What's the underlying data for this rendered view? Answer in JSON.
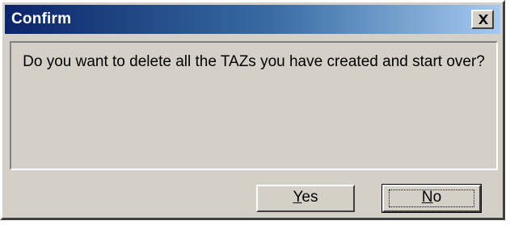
{
  "dialog": {
    "title": "Confirm",
    "close_icon": "close-icon",
    "message": "Do you want to delete all the TAZs you have created and start over?",
    "buttons": {
      "yes": {
        "mnemonic": "Y",
        "rest": "es"
      },
      "no": {
        "mnemonic": "N",
        "rest": "o"
      }
    },
    "colors": {
      "titlebar_start": "#0a246a",
      "titlebar_end": "#a6caf0",
      "face": "#d4d0c8"
    }
  }
}
